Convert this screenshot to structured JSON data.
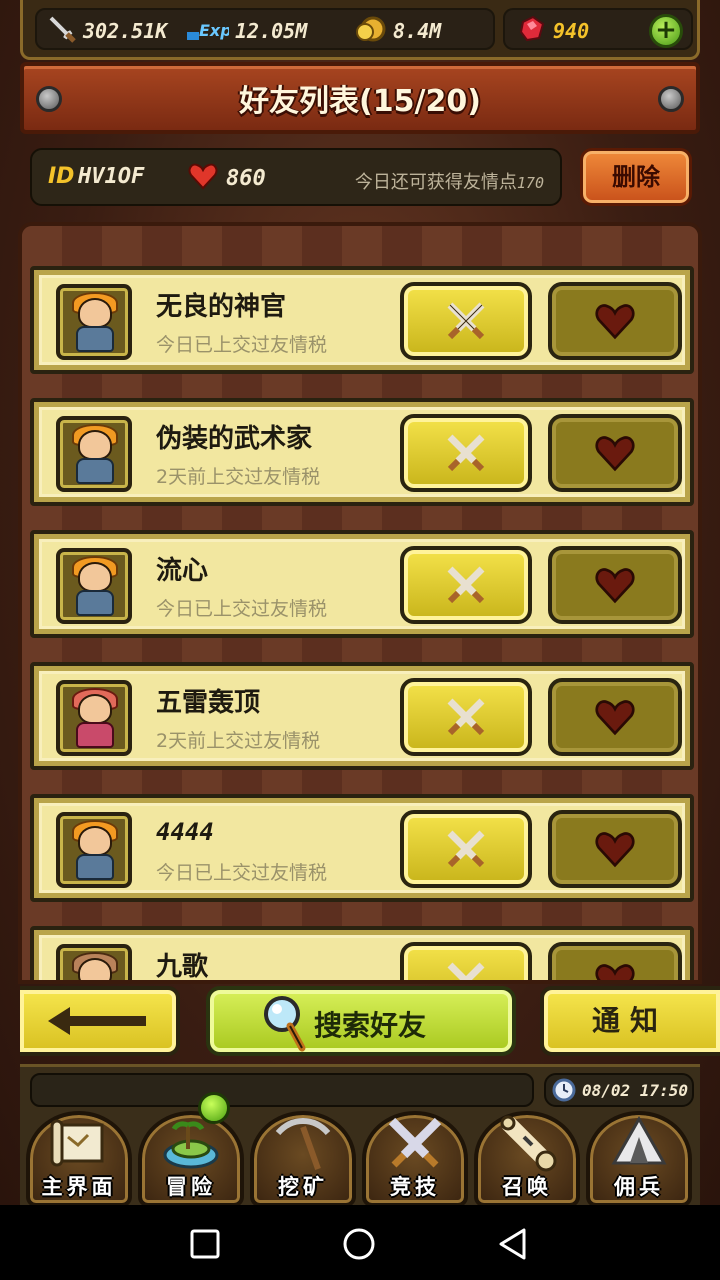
{
  "resources": {
    "attack": "302.51K",
    "exp": "12.05M",
    "coins": "8.4M",
    "gems": "940",
    "add_label": "+"
  },
  "header": {
    "title": "好友列表(15/20)"
  },
  "info": {
    "id_label": "ID",
    "id_value": "HV1OF",
    "hearts": "860",
    "friendship_text": "今日还可获得友情点",
    "friendship_points": "170",
    "delete_label": "删除"
  },
  "friends": [
    {
      "name": "无良的神官",
      "status": "今日已上交过友情税"
    },
    {
      "name": "伪装的武术家",
      "status": "2天前上交过友情税"
    },
    {
      "name": "流心",
      "status": "今日已上交过友情税"
    },
    {
      "name": "五雷轰顶",
      "status": "2天前上交过友情税"
    },
    {
      "name": "4444",
      "status": "今日已上交过友情税"
    },
    {
      "name": "九歌",
      "status": ""
    }
  ],
  "controls": {
    "search_label": "搜索好友",
    "notify_label": "通知"
  },
  "nav": {
    "time": "08/02 17:50",
    "items": [
      "主界面",
      "冒险",
      "挖矿",
      "竞技",
      "召唤",
      "佣兵"
    ]
  },
  "colors": {
    "accent_yellow": "#f4e24a",
    "accent_green": "#a8c81e",
    "delete_orange": "#e0702a",
    "title_red": "#a84520"
  }
}
